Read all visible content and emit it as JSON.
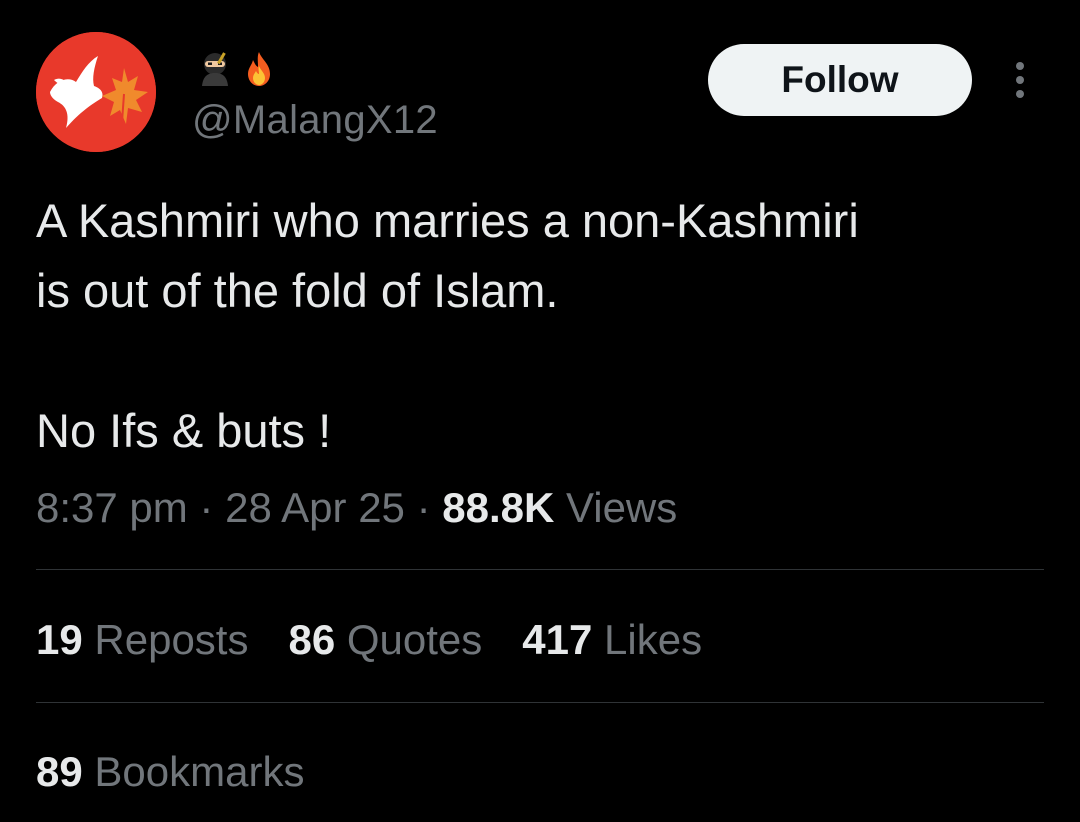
{
  "author": {
    "display_name_icons": [
      "ninja-icon",
      "fire-icon"
    ],
    "handle": "@MalangX12",
    "avatar_icon": "dove-maple-leaf-avatar"
  },
  "actions": {
    "follow_label": "Follow",
    "more_icon": "more-vertical-icon"
  },
  "tweet": {
    "line1": "A Kashmiri who marries a non-Kashmiri",
    "line2": "is out of the fold of Islam.",
    "line3": "No Ifs & buts !"
  },
  "meta": {
    "time": "8:37 pm",
    "separator": " · ",
    "date": "28 Apr 25",
    "views_count": "88.8K",
    "views_label": " Views"
  },
  "stats": {
    "reposts": {
      "count": "19",
      "label": "Reposts"
    },
    "quotes": {
      "count": "86",
      "label": "Quotes"
    },
    "likes": {
      "count": "417",
      "label": "Likes"
    },
    "bookmarks": {
      "count": "89",
      "label": "Bookmarks"
    }
  },
  "colors": {
    "background": "#000000",
    "primary_text": "#e7e9ea",
    "secondary_text": "#71767b",
    "follow_button_bg": "#eff3f4",
    "follow_button_text": "#0f1419",
    "divider": "#2f3336",
    "avatar_bg": "#e8392b",
    "leaf_orange": "#f08a2c"
  }
}
